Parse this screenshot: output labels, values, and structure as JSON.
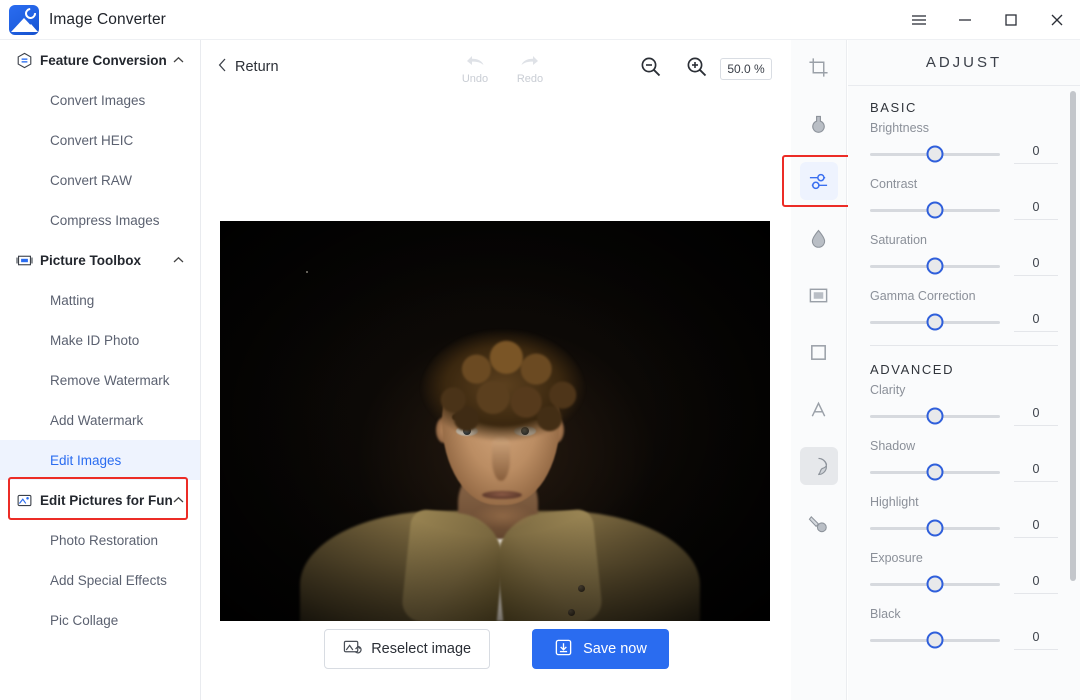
{
  "app": {
    "title": "Image Converter",
    "logo_icon": "image-converter-logo"
  },
  "window_controls": {
    "menu": "menu-icon",
    "minimize": "minimize-icon",
    "maximize": "maximize-icon",
    "close": "close-icon"
  },
  "sidebar": {
    "groups": [
      {
        "label": "Feature Conversion",
        "icon": "feature-conversion-icon",
        "expanded": true,
        "caret": "chevron-up-icon",
        "items": [
          {
            "label": "Convert Images",
            "selected": false
          },
          {
            "label": "Convert HEIC",
            "selected": false
          },
          {
            "label": "Convert RAW",
            "selected": false
          },
          {
            "label": "Compress Images",
            "selected": false
          }
        ]
      },
      {
        "label": "Picture Toolbox",
        "icon": "picture-toolbox-icon",
        "expanded": true,
        "caret": "chevron-up-icon",
        "items": [
          {
            "label": "Matting",
            "selected": false
          },
          {
            "label": "Make ID Photo",
            "selected": false
          },
          {
            "label": "Remove Watermark",
            "selected": false
          },
          {
            "label": "Add Watermark",
            "selected": false
          },
          {
            "label": "Edit Images",
            "selected": true
          }
        ]
      },
      {
        "label": "Edit Pictures for Fun",
        "icon": "edit-pictures-fun-icon",
        "expanded": true,
        "caret": "chevron-up-icon",
        "items": [
          {
            "label": "Photo Restoration",
            "selected": false
          },
          {
            "label": "Add Special Effects",
            "selected": false
          },
          {
            "label": "Pic Collage",
            "selected": false
          }
        ]
      }
    ]
  },
  "editor": {
    "return_label": "Return",
    "back_icon": "chevron-left-icon",
    "undo_label": "Undo",
    "undo_icon": "undo-arrow-icon",
    "redo_label": "Redo",
    "redo_icon": "redo-arrow-icon",
    "zoom_out_icon": "zoom-out-icon",
    "zoom_in_icon": "zoom-in-icon",
    "zoom_value": "50.0 %",
    "photo_alt": "portrait-photo-young-man-curly-hair-dark-background"
  },
  "actions": {
    "reselect_label": "Reselect image",
    "reselect_icon": "reselect-image-icon",
    "save_label": "Save now",
    "save_icon": "download-save-icon"
  },
  "tool_rail": {
    "tools": [
      {
        "name": "crop-tool",
        "icon": "crop-icon",
        "state": "normal"
      },
      {
        "name": "filter-tool",
        "icon": "flask-icon",
        "state": "normal"
      },
      {
        "name": "adjust-tool",
        "icon": "adjust-sliders-icon",
        "state": "active"
      },
      {
        "name": "blur-tool",
        "icon": "water-drop-icon",
        "state": "normal"
      },
      {
        "name": "frame-tool",
        "icon": "frame-icon",
        "state": "normal"
      },
      {
        "name": "border-tool",
        "icon": "border-square-icon",
        "state": "normal"
      },
      {
        "name": "text-tool",
        "icon": "text-a-icon",
        "state": "normal"
      },
      {
        "name": "sticker-tool",
        "icon": "sticker-icon",
        "state": "hovered"
      },
      {
        "name": "brush-tool",
        "icon": "brush-icon",
        "state": "normal"
      }
    ]
  },
  "adjust_panel": {
    "title": "ADJUST",
    "sections": [
      {
        "title": "BASIC",
        "controls": [
          {
            "label": "Brightness",
            "value": "0",
            "position_pct": 50
          },
          {
            "label": "Contrast",
            "value": "0",
            "position_pct": 50
          },
          {
            "label": "Saturation",
            "value": "0",
            "position_pct": 50
          },
          {
            "label": "Gamma Correction",
            "value": "0",
            "position_pct": 50
          }
        ]
      },
      {
        "title": "ADVANCED",
        "controls": [
          {
            "label": "Clarity",
            "value": "0",
            "position_pct": 50
          },
          {
            "label": "Shadow",
            "value": "0",
            "position_pct": 50
          },
          {
            "label": "Highlight",
            "value": "0",
            "position_pct": 50
          },
          {
            "label": "Exposure",
            "value": "0",
            "position_pct": 50
          },
          {
            "label": "Black",
            "value": "0",
            "position_pct": 50
          }
        ]
      }
    ]
  },
  "colors": {
    "accent": "#2a6cf0",
    "highlight_box": "#ec2c26",
    "selected_nav_bg": "#eef3fe",
    "panel_bg": "#fafbfc",
    "muted_text": "#8b9099"
  }
}
